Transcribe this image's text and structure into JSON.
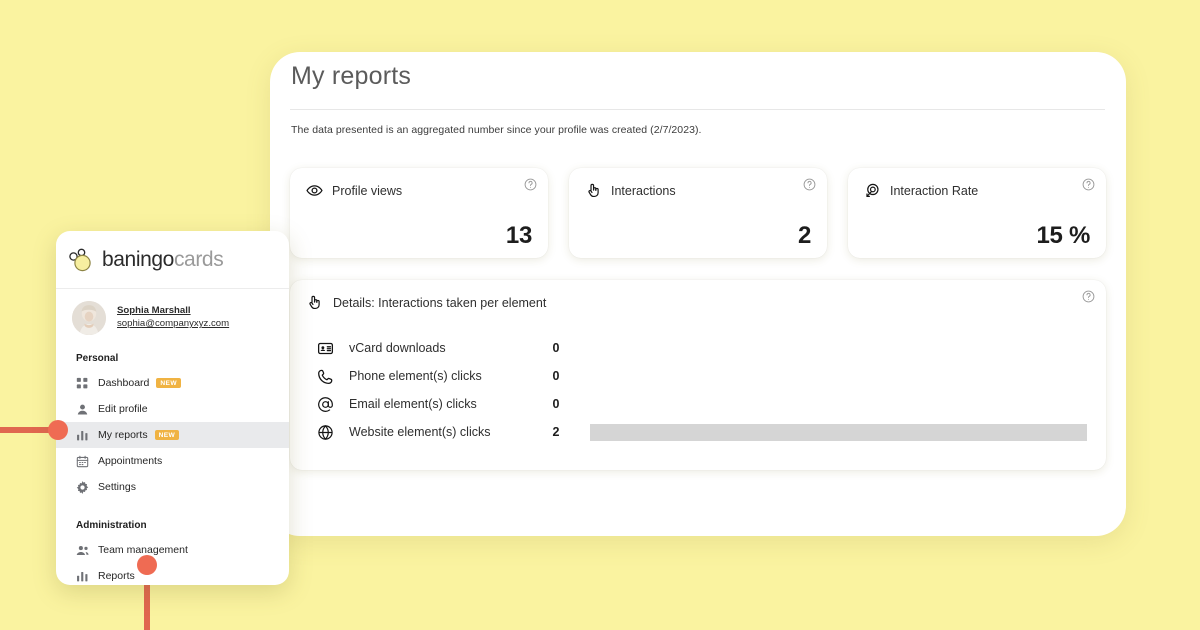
{
  "theme": {
    "background": "#faf3a0",
    "accent_badge": "#f0b343",
    "annotation": "#ef6b53",
    "active_nav_bg": "#e9eaec",
    "bar_gray": "#d5d5d5"
  },
  "report": {
    "title": "My reports",
    "subtitle": "The data presented is an aggregated number since your profile was created (2/7/2023).",
    "stats": [
      {
        "icon": "eye-icon",
        "label": "Profile views",
        "value": "13",
        "help": "help-icon"
      },
      {
        "icon": "tap-hand-icon",
        "label": "Interactions",
        "value": "2",
        "help": "help-icon"
      },
      {
        "icon": "interaction-rate-icon",
        "label": "Interaction Rate",
        "value": "15 %",
        "help": "help-icon"
      }
    ],
    "details": {
      "icon": "tap-hand-icon",
      "title": "Details: Interactions taken per element",
      "help": "help-icon",
      "rows": [
        {
          "icon": "vcard-icon",
          "label": "vCard downloads",
          "value": "0",
          "bar_percent": 0
        },
        {
          "icon": "phone-icon",
          "label": "Phone element(s) clicks",
          "value": "0",
          "bar_percent": 0
        },
        {
          "icon": "at-icon",
          "label": "Email element(s) clicks",
          "value": "0",
          "bar_percent": 0
        },
        {
          "icon": "globe-icon",
          "label": "Website element(s) clicks",
          "value": "2",
          "bar_percent": 100
        }
      ]
    }
  },
  "sidebar": {
    "logo": {
      "brand": "baningo",
      "suffix": "cards",
      "mark": "bubbles-logo-icon"
    },
    "profile": {
      "avatar": "user-avatar",
      "name": "Sophia Marshall",
      "email": "sophia@companyxyz.com"
    },
    "groups": [
      {
        "title": "Personal",
        "items": [
          {
            "icon": "dashboard-icon",
            "label": "Dashboard",
            "badge": "NEW",
            "active": false
          },
          {
            "icon": "person-icon",
            "label": "Edit profile",
            "badge": "",
            "active": false
          },
          {
            "icon": "bar-chart-icon",
            "label": "My reports",
            "badge": "NEW",
            "active": true
          },
          {
            "icon": "calendar-icon",
            "label": "Appointments",
            "badge": "",
            "active": false
          },
          {
            "icon": "gear-icon",
            "label": "Settings",
            "badge": "",
            "active": false
          }
        ]
      },
      {
        "title": "Administration",
        "items": [
          {
            "icon": "team-icon",
            "label": "Team management",
            "badge": "",
            "active": false
          },
          {
            "icon": "bar-chart-icon",
            "label": "Reports",
            "badge": "",
            "active": false
          }
        ]
      }
    ]
  }
}
